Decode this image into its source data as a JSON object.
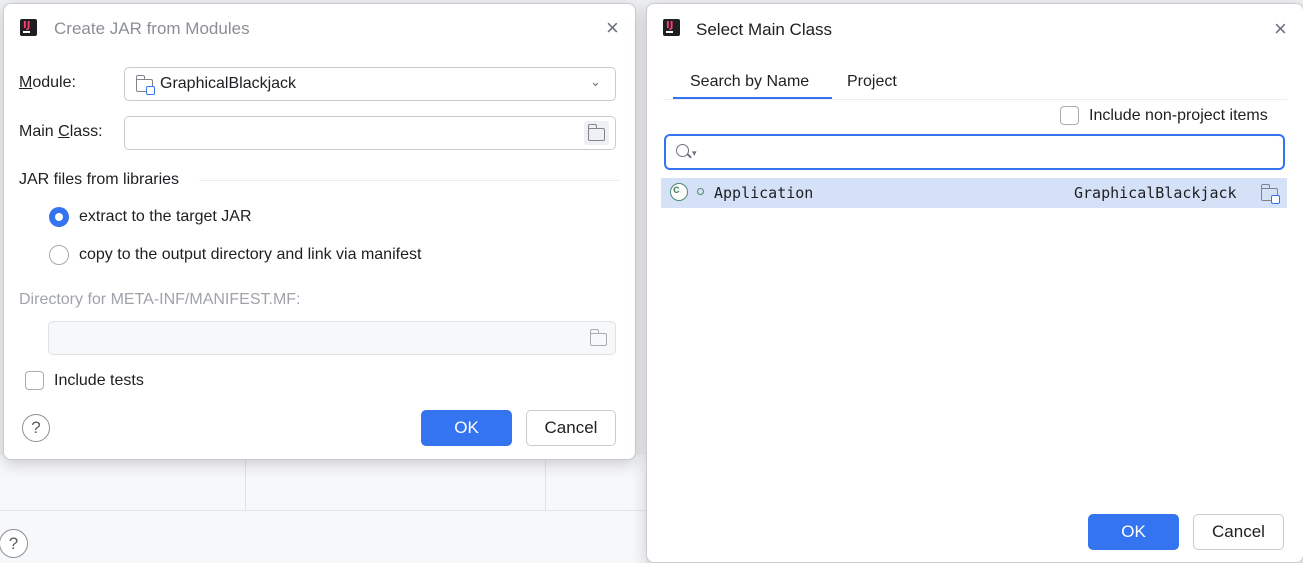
{
  "background": {
    "help_label": "?"
  },
  "jar_dialog": {
    "title": "Create JAR from Modules",
    "close_label": "×",
    "module_label_pre": "",
    "module_label_mnemonic": "M",
    "module_label_post": "odule:",
    "module_value": "GraphicalBlackjack",
    "main_class_label_pre": "Main ",
    "main_class_label_mnemonic": "C",
    "main_class_label_post": "lass:",
    "main_class_value": "",
    "libraries_heading": "JAR files from libraries",
    "radio_extract": "extract to the target JAR",
    "radio_copy": "copy to the output directory and link via manifest",
    "manifest_dir_label": "Directory for META-INF/MANIFEST.MF:",
    "manifest_dir_value": "",
    "include_tests_label": "Include tests",
    "help_label": "?",
    "ok_label": "OK",
    "cancel_label": "Cancel"
  },
  "main_class_dialog": {
    "title": "Select Main Class",
    "close_label": "×",
    "tabs": [
      {
        "label": "Search by Name",
        "selected": true
      },
      {
        "label": "Project",
        "selected": false
      }
    ],
    "include_non_project_label": "Include non-project items",
    "search_value": "",
    "results": [
      {
        "class_name": "Application",
        "module": "GraphicalBlackjack",
        "icon": "class-icon"
      }
    ],
    "ok_label": "OK",
    "cancel_label": "Cancel"
  },
  "colors": {
    "accent": "#3574f0",
    "selection": "#d5e1f7",
    "class_green": "#4d8a6d"
  }
}
